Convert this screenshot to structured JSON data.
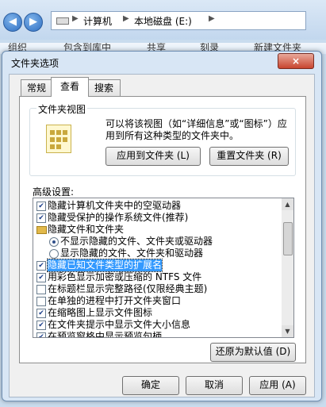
{
  "explorer": {
    "address": [
      "计算机",
      "本地磁盘 (E:)"
    ],
    "cmd_items": [
      "组织",
      "包含到库中",
      "共享",
      "刻录",
      "新建文件夹"
    ]
  },
  "dialog": {
    "title": "文件夹选项",
    "close_label": "×",
    "tabs": [
      "常规",
      "查看",
      "搜索"
    ],
    "active_tab": "查看",
    "folder_views": {
      "title": "文件夹视图",
      "description": "可以将该视图（如“详细信息”或“图标”）应用到所有这种类型的文件夹中。",
      "apply_label": "应用到文件夹 (L)",
      "reset_label": "重置文件夹 (R)"
    },
    "advanced": {
      "label": "高级设置:",
      "items": [
        {
          "type": "checkbox",
          "checked": true,
          "text": "隐藏计算机文件夹中的空驱动器"
        },
        {
          "type": "checkbox",
          "checked": true,
          "text": "隐藏受保护的操作系统文件(推荐)"
        },
        {
          "type": "folder",
          "text": "隐藏文件和文件夹"
        },
        {
          "type": "radio",
          "checked": true,
          "text": "不显示隐藏的文件、文件夹或驱动器"
        },
        {
          "type": "radio",
          "checked": false,
          "text": "显示隐藏的文件、文件夹和驱动器"
        },
        {
          "type": "checkbox",
          "checked": true,
          "text": "隐藏已知文件类型的扩展名",
          "highlighted": true
        },
        {
          "type": "checkbox",
          "checked": true,
          "text": "用彩色显示加密或压缩的 NTFS 文件"
        },
        {
          "type": "checkbox",
          "checked": false,
          "text": "在标题栏显示完整路径(仅限经典主题)"
        },
        {
          "type": "checkbox",
          "checked": false,
          "text": "在单独的进程中打开文件夹窗口"
        },
        {
          "type": "checkbox",
          "checked": true,
          "text": "在缩略图上显示文件图标"
        },
        {
          "type": "checkbox",
          "checked": true,
          "text": "在文件夹提示中显示文件大小信息"
        },
        {
          "type": "checkbox",
          "checked": true,
          "text": "在预览窗格中显示预览句柄"
        }
      ]
    },
    "restore_label": "还原为默认值 (D)",
    "ok_label": "确定",
    "cancel_label": "取消",
    "apply_label": "应用 (A)"
  }
}
